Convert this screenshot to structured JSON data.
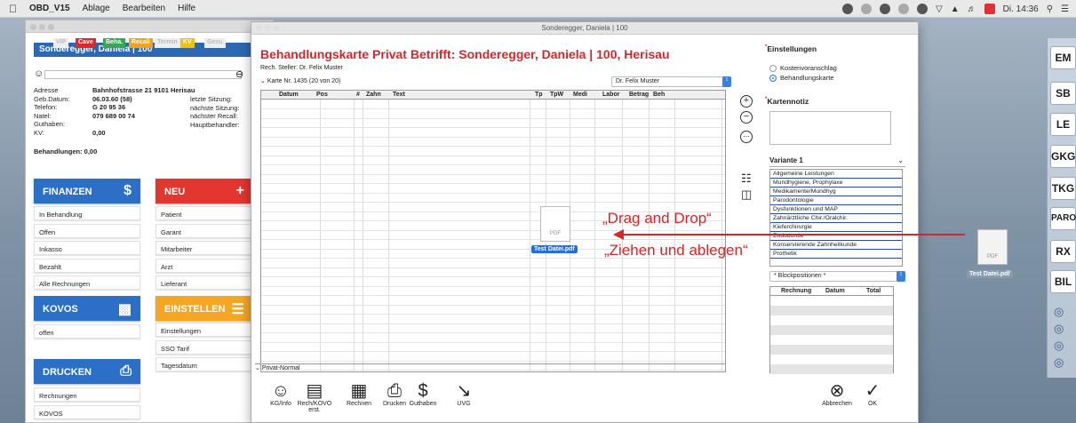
{
  "menubar": {
    "app": "OBD_V15",
    "items": [
      "Ablage",
      "Bearbeiten",
      "Hilfe"
    ],
    "clock": "Di. 14:36"
  },
  "patient": {
    "title": "Sonderegger, Daniela | 100",
    "tags": [
      {
        "label": "VIP",
        "color": "#eeeeee"
      },
      {
        "label": "Cave",
        "color": "#e2262b"
      },
      {
        "label": "Beha.",
        "color": "#35a853"
      },
      {
        "label": "Recall",
        "color": "#f4a21c"
      },
      {
        "label": "Termin",
        "color": "#eeeeee"
      },
      {
        "label": "KV",
        "color": "#f3c200"
      },
      {
        "label": "Gesu",
        "color": "#eeeeee"
      }
    ],
    "rows": [
      {
        "k": "Adresse",
        "v": "Bahnhofstrasse 21  9101 Herisau"
      },
      {
        "k": "Geb.Datum:",
        "v": "06.03.60  (58)"
      },
      {
        "k": "Telefon:",
        "v": "G 20 95 36"
      },
      {
        "k": "Natel:",
        "v": "079 689 00 74"
      },
      {
        "k": "Guthaben:",
        "v": ""
      },
      {
        "k": "KV:",
        "v": "0,00"
      }
    ],
    "right_rows": [
      "letzte Sitzung:",
      "nächste Sitzung:",
      "nächster Recall:",
      "Hauptbehandler:"
    ],
    "behandlungen": "Behandlungen: 0,00"
  },
  "tiles": {
    "finanzen": "FINANZEN",
    "neu": "NEU",
    "kovos": "KOVOS",
    "einstellen": "EINSTELLEN",
    "drucken": "DRUCKEN"
  },
  "finanzen_items": [
    "In Behandlung",
    "Offen",
    "Inkasso",
    "Bezahlt",
    "Alle Rechnungen"
  ],
  "neu_items": [
    "Patient",
    "Garant",
    "Mitarbeiter",
    "Arzt",
    "Lieferant"
  ],
  "kovos_items": [
    "offen"
  ],
  "einstellen_items": [
    "Einstellungen",
    "SSO Tarif",
    "Tagesdatum"
  ],
  "drucken_items": [
    "Rechnungen",
    "KOVOS"
  ],
  "main": {
    "window_title": "Sonderegger, Daniela | 100",
    "heading": "Behandlungskarte Privat Betrifft: Sonderegger, Daniela | 100, Herisau",
    "steller": "Rech. Steller: Dr. Felix Muster",
    "karte": "Karte Nr. 1435 (20 von 20)",
    "arzt": "Dr. Felix Muster",
    "columns": [
      "Datum",
      "Pos",
      "#",
      "Zahn",
      "Text",
      "Tp",
      "TpW",
      "Medi",
      "Labor",
      "Betrag",
      "Beh"
    ],
    "footer": "Privat-Normal",
    "toolbar": [
      {
        "icon": "person-icon",
        "label": "KG/Info"
      },
      {
        "icon": "document-icon",
        "label": "Rech/KOVO erst."
      },
      {
        "icon": "grid-icon",
        "label": "Rechnen"
      },
      {
        "icon": "printer-icon",
        "label": "Drucken"
      },
      {
        "icon": "dollar-icon",
        "label": "Guthaben"
      },
      {
        "icon": "collapse-arrows-icon",
        "label": "UVG"
      }
    ],
    "cancel": "Abbrechen",
    "ok": "OK"
  },
  "settings": {
    "title": "Einstellungen",
    "options": [
      "Kostenvoranschlag",
      "Behandlungskarte"
    ],
    "selected": 1,
    "kartennotiz": "Kartennotiz",
    "variante": "Variante 1",
    "variants": [
      "Allgemeine Leistungen",
      "Mundhygiene, Prophylaxe",
      "Medikamente/Mundhyg",
      "Parodontologie",
      "Dysfunktionen und MAP",
      "Zahnärztliche Chir./Oralchir.",
      "Kieferchirurgie",
      "Endodontie",
      "Konservierende Zahnheilkunde",
      "Prothetik"
    ],
    "block": "* Blockpositionen *",
    "rech_cols": [
      "Rechnung",
      "Datum",
      "Total"
    ]
  },
  "dragdrop": {
    "line1": "„Drag and Drop“",
    "line2": "„Ziehen und ablegen“",
    "file": "Test Datei.pdf",
    "pdf": "PDF"
  },
  "dock": [
    "EM",
    "SB",
    "LE",
    "GKG",
    "TKG",
    "PARO",
    "RX",
    "BIL"
  ]
}
